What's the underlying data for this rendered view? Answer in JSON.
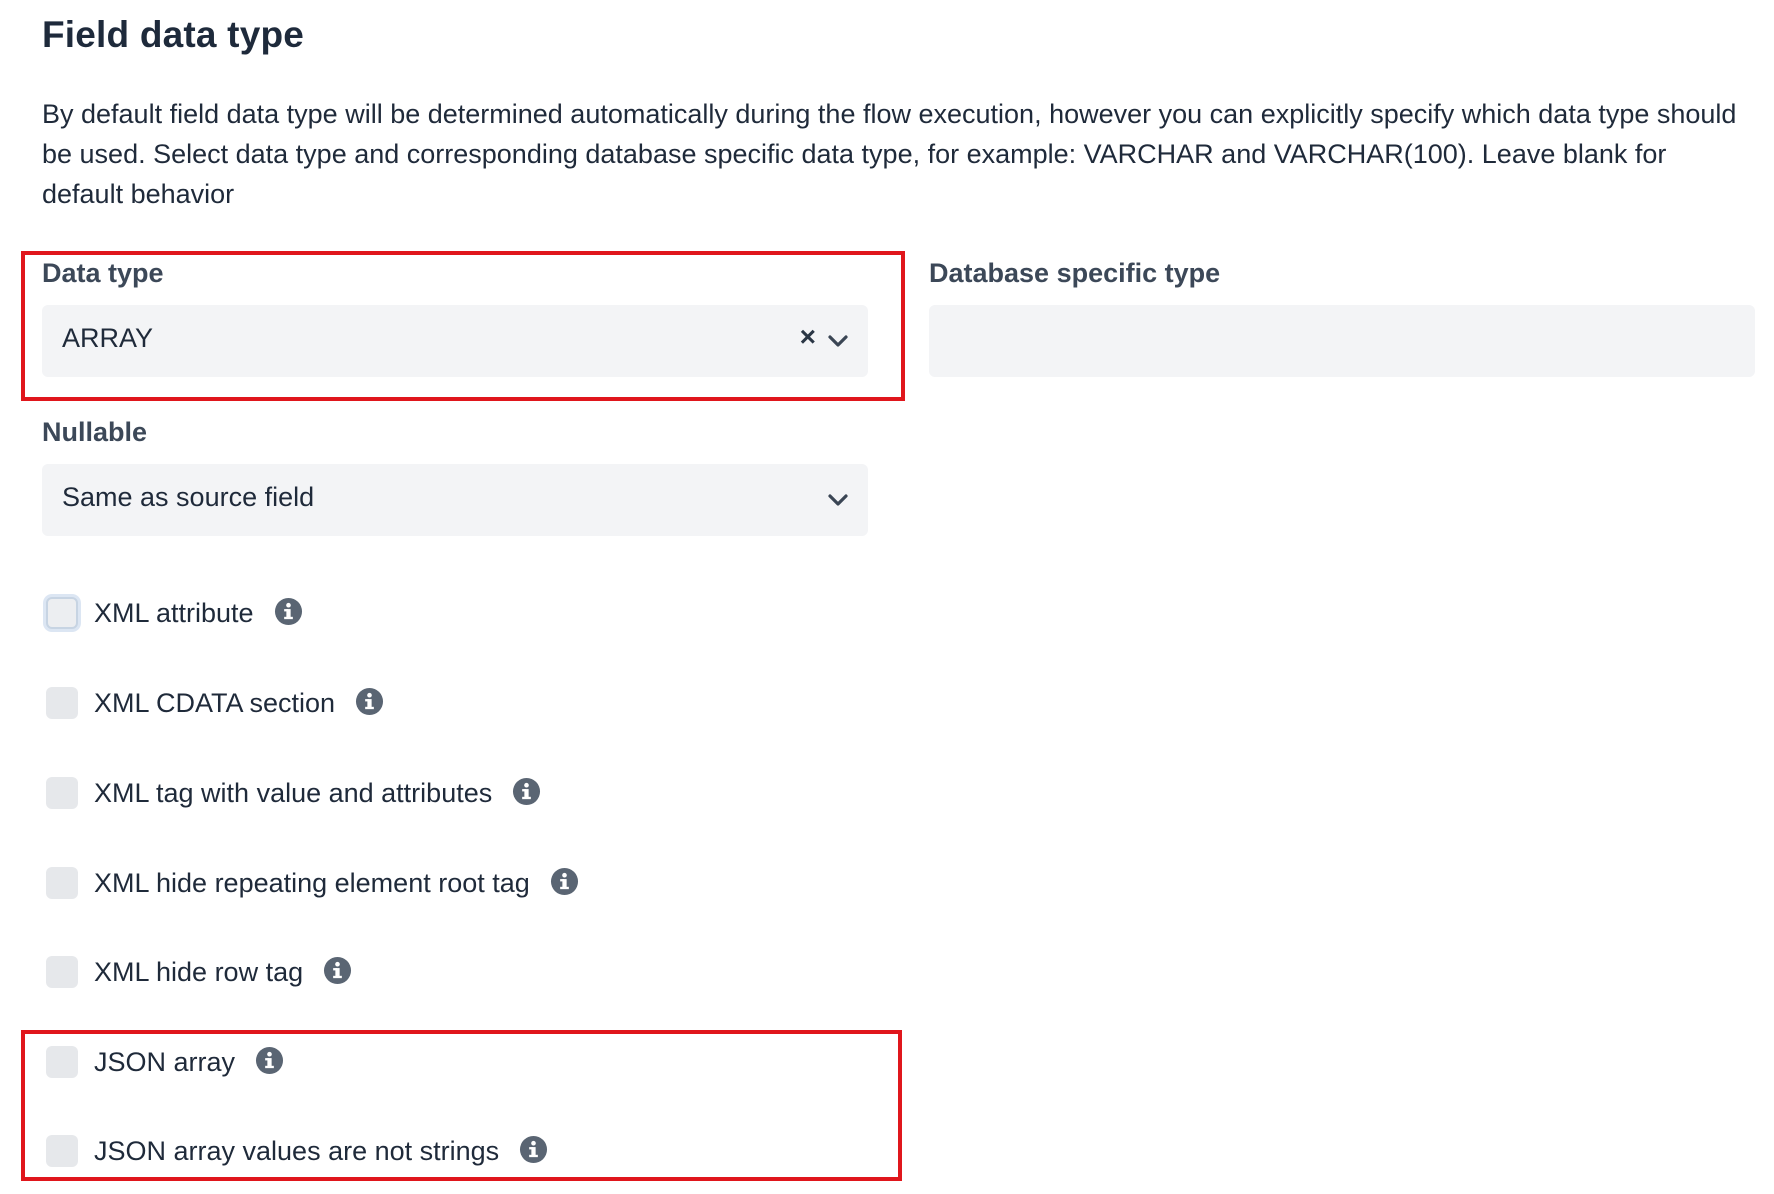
{
  "section": {
    "title": "Field data type",
    "description": "By default field data type will be determined automatically during the flow execution, however you can explicitly specify which data type should be used. Select data type and corresponding database specific data type, for example: VARCHAR and VARCHAR(100). Leave blank for default behavior"
  },
  "data_type": {
    "label": "Data type",
    "value": "ARRAY",
    "clear_symbol": "×"
  },
  "db_specific_type": {
    "label": "Database specific type",
    "value": "",
    "placeholder": ""
  },
  "nullable": {
    "label": "Nullable",
    "value": "Same as source field"
  },
  "options": [
    {
      "label": "XML attribute",
      "checked": false
    },
    {
      "label": "XML CDATA section",
      "checked": false
    },
    {
      "label": "XML tag with value and attributes",
      "checked": false
    },
    {
      "label": "XML hide repeating element root tag",
      "checked": false
    },
    {
      "label": "XML hide row tag",
      "checked": false
    },
    {
      "label": "JSON array",
      "checked": false
    },
    {
      "label": "JSON array values are not strings",
      "checked": false
    }
  ],
  "colors": {
    "highlight": "#e0161c",
    "input_bg": "#f3f4f6",
    "icon": "#5a6573"
  },
  "icons": {
    "info": "info-circle-icon",
    "chevron": "chevron-down-icon",
    "clear": "clear-x-icon"
  }
}
